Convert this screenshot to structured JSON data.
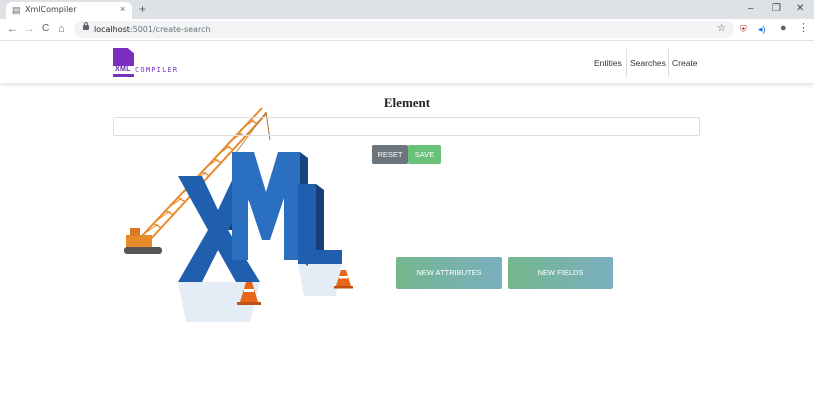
{
  "browser": {
    "tab_title": "XmlCompiler",
    "tab_close": "×",
    "new_tab": "+",
    "url_host": "localhost",
    "url_path": ":5001/create-search",
    "window_controls": [
      "–",
      "❐",
      "✕"
    ],
    "nav_icons": [
      "←",
      "→",
      "C",
      "⌂"
    ],
    "star": "☆"
  },
  "app": {
    "logo_word1": "XML",
    "logo_word2": "COMPILER",
    "nav": [
      "Entities",
      "Searches",
      "Create"
    ]
  },
  "main": {
    "heading": "Element",
    "input_value": "",
    "reset_label": "RESET",
    "save_label": "SAVE",
    "new_attributes_label": "NEW ATTRIBUTES",
    "new_fields_label": "NEW FIELDS"
  },
  "illustration": {
    "letters": "XML",
    "colors": {
      "letter_blue": "#1f5fae",
      "crane_orange": "#e88a2a",
      "cone_orange": "#e8661a"
    }
  },
  "colors": {
    "brand_purple": "#7b2fbf",
    "reset_gray": "#6c757d",
    "save_green": "#67c177"
  }
}
